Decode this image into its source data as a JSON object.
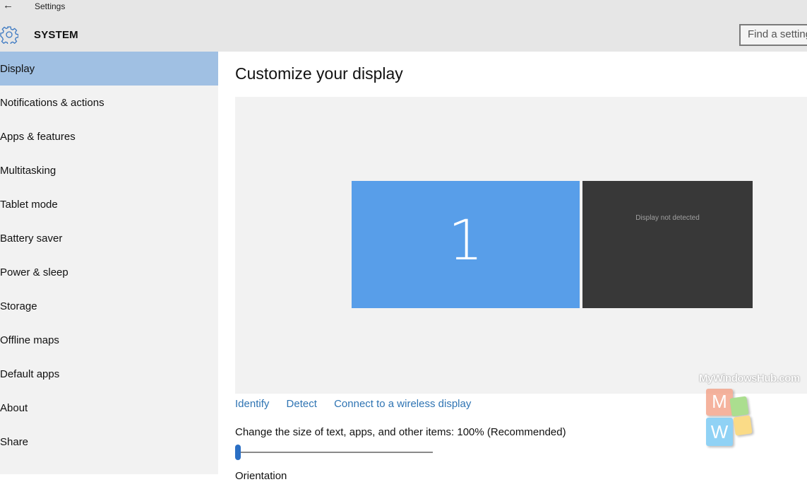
{
  "header": {
    "back_icon": "back-arrow-icon",
    "back_glyph": "←",
    "app_title": "Settings",
    "section_icon": "gear-icon",
    "section_title": "SYSTEM",
    "search_placeholder": "Find a setting"
  },
  "sidebar": {
    "items": [
      {
        "label": "Display",
        "selected": true
      },
      {
        "label": "Notifications & actions"
      },
      {
        "label": "Apps & features"
      },
      {
        "label": "Multitasking"
      },
      {
        "label": "Tablet mode"
      },
      {
        "label": "Battery saver"
      },
      {
        "label": "Power & sleep"
      },
      {
        "label": "Storage"
      },
      {
        "label": "Offline maps"
      },
      {
        "label": "Default apps"
      },
      {
        "label": "About"
      },
      {
        "label": "Share"
      }
    ]
  },
  "main": {
    "title": "Customize your display",
    "monitors": [
      {
        "label": "1",
        "color": "#589ee9"
      },
      {
        "label": "Display not detected",
        "color": "#383838"
      }
    ],
    "links": {
      "identify": "Identify",
      "detect": "Detect",
      "wireless": "Connect to a wireless display"
    },
    "scale_label": "Change the size of text, apps, and other items: 100% (Recommended)",
    "scale_slider_fraction": 0,
    "next_setting_label": "Orientation"
  },
  "watermark": {
    "text": "MyWindowsHub.com",
    "letters": [
      "M",
      "W"
    ]
  },
  "colors": {
    "accent": "#2b6fc4",
    "link": "#2f74b3",
    "selected_nav": "#a0c0e3"
  }
}
